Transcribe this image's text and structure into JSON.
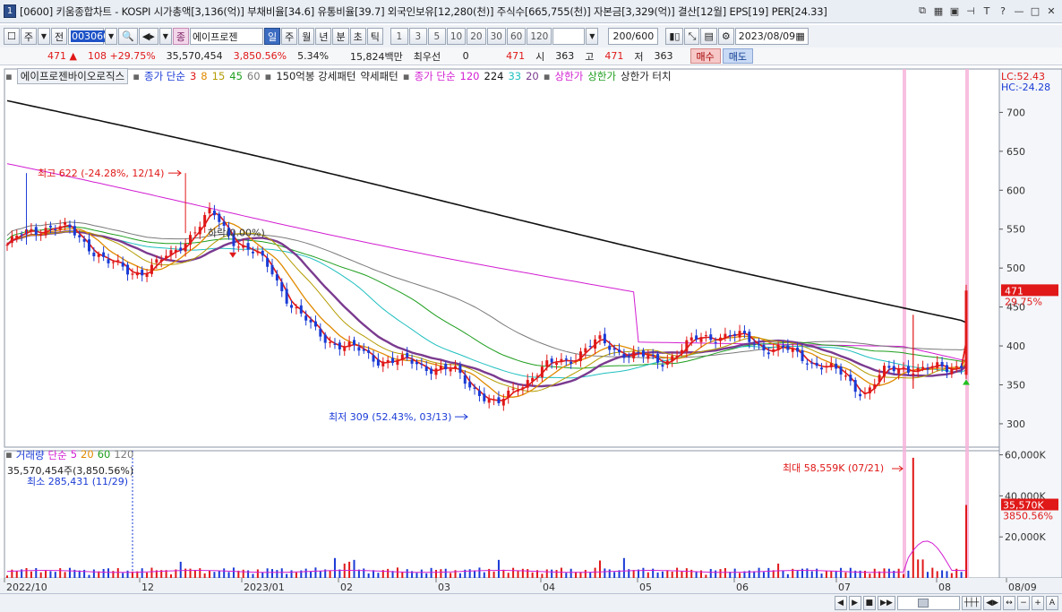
{
  "titlebar": {
    "num": "1",
    "title": "[0600] 키움종합차트 - KOSPI 시가총액[3,136(억)] 부채비율[34.6] 유통비율[39.7] 외국인보유[12,280(천)] 주식수[665,755(천)] 자본금[3,329(억)] 결산[12월] EPS[19] PER[24.33]"
  },
  "toolbar": {
    "mode_a": "주",
    "mode_b": "전",
    "code": "003060",
    "name_btn": "종",
    "name": "에이프로젠",
    "periods": [
      "일",
      "주",
      "월",
      "년",
      "분",
      "초",
      "틱"
    ],
    "minutes": [
      "1",
      "3",
      "5",
      "10",
      "20",
      "30",
      "60",
      "120"
    ],
    "count": "200/600",
    "date": "2023/08/09"
  },
  "quote": {
    "price": "471",
    "change": "108 +29.75%",
    "volume": "35,570,454",
    "vol_ratio": "3,850.56%",
    "turnover": "5.34%",
    "amount": "15,824백만",
    "pref_label": "최우선",
    "pref_value": "0",
    "pref_price": "471",
    "open_label": "시",
    "open": "363",
    "high_label": "고",
    "high": "471",
    "low_label": "저",
    "low": "363",
    "buy": "매수",
    "sell": "매도"
  },
  "legend": {
    "name": "에이프로젠바이오로직스",
    "ma_label": "종가 단순",
    "ma3": "3",
    "ma8": "8",
    "ma15": "15",
    "ma45": "45",
    "ma60": "60",
    "pattern150": "150억봉 강세패턴",
    "weak": "약세패턴",
    "ma_label2": "종가 단순",
    "ma120": "120",
    "ma224": "224",
    "ma33": "33",
    "ma20": "20",
    "upper1": "상한가",
    "upper2": "상한가",
    "upper3": "상한가 터치"
  },
  "vol_legend": {
    "name": "거래량",
    "label": "단순",
    "v5": "5",
    "v20": "20",
    "v60": "60",
    "v120": "120"
  },
  "annotations": {
    "high": "최고 622 (-24.28%, 12/14)",
    "low": "최저 309 (52.43%, 03/13)",
    "fall": "하락(0.00%)",
    "lc": "LC:52.43",
    "hc": "HC:-24.28",
    "price_tag": "471",
    "price_pct": "29.75%",
    "vol_now": "35,570,454주(3,850.56%)",
    "vol_min": "최소 285,431 (11/29)",
    "vol_max": "최대 58,559K (07/21)",
    "vol_tag": "35,570K",
    "vol_tag_pct": "3850.56%"
  },
  "chart_data": {
    "type": "candlestick",
    "price_axis": [
      "700",
      "650",
      "600",
      "550",
      "500",
      "450",
      "400",
      "350",
      "300"
    ],
    "volume_axis": [
      "60,000K",
      "40,000K",
      "20,000K"
    ],
    "x_labels": [
      "2022/10",
      "12",
      "2023/01",
      "02",
      "03",
      "04",
      "05",
      "06",
      "07",
      "08",
      "08/09"
    ],
    "ylim": [
      270,
      735
    ],
    "vol_ylim": [
      0,
      62000
    ],
    "last": {
      "price": 471,
      "volume_k": 35570
    },
    "key_points": [
      {
        "label": "high",
        "date": "12/14",
        "price": 622
      },
      {
        "label": "low",
        "date": "03/13",
        "price": 309
      },
      {
        "label": "max_volume",
        "date": "07/21",
        "volume_k": 58559
      },
      {
        "label": "min_volume",
        "date": "11/29",
        "volume": 285431
      }
    ],
    "price_path": [
      530,
      545,
      555,
      548,
      530,
      505,
      495,
      500,
      515,
      545,
      570,
      540,
      520,
      495,
      450,
      420,
      405,
      395,
      385,
      380,
      378,
      372,
      365,
      345,
      320,
      350,
      365,
      380,
      390,
      405,
      395,
      385,
      380,
      395,
      410,
      415,
      410,
      400,
      395,
      385,
      375,
      360,
      340,
      365,
      375,
      368,
      372,
      380,
      471
    ],
    "colors": {
      "up": "#e01818",
      "down": "#1a3bd6",
      "ma3": "#e01818",
      "ma8": "#e08a00",
      "ma15": "#b39b00",
      "ma45": "#1e9e1e",
      "ma60": "#7a7a7a",
      "ma120": "#d21ed2",
      "ma224": "#111111",
      "ma33": "#1fbfbf",
      "ma20": "#7a3a8f"
    }
  }
}
